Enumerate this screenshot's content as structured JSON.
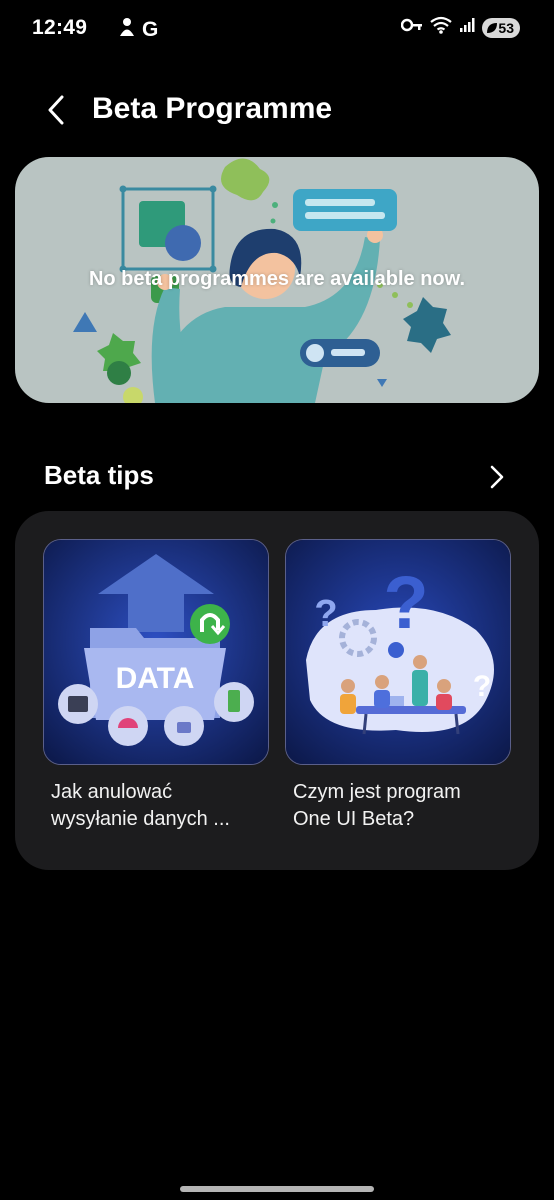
{
  "status_bar": {
    "time": "12:49",
    "carrier": "G",
    "battery": "53"
  },
  "header": {
    "title": "Beta Programme"
  },
  "banner": {
    "message": "No beta programmes are available now."
  },
  "tips": {
    "title": "Beta tips",
    "items": [
      {
        "caption_line1": "Jak anulować",
        "caption_line2": "wysyłanie danych ...",
        "thumb_label": "DATA"
      },
      {
        "caption_line1": "Czym jest program",
        "caption_line2": "One UI Beta?"
      }
    ]
  },
  "colors": {
    "background": "#000000",
    "card": "#1c1c1e",
    "banner_bg": "#b9c4c2"
  }
}
